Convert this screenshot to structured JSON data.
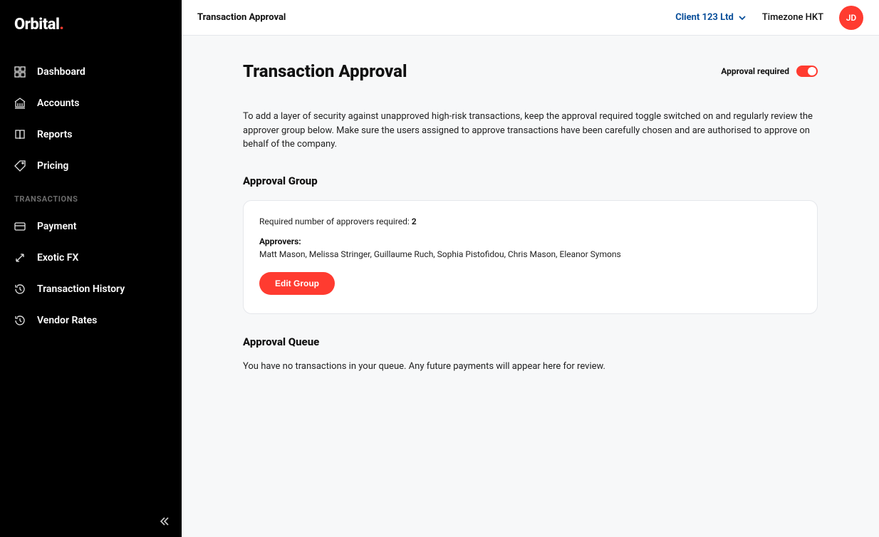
{
  "brand": {
    "name": "Orbital",
    "dot": "."
  },
  "sidebar": {
    "items": [
      {
        "label": "Dashboard",
        "icon": "dashboard-icon"
      },
      {
        "label": "Accounts",
        "icon": "bank-icon"
      },
      {
        "label": "Reports",
        "icon": "book-icon"
      },
      {
        "label": "Pricing",
        "icon": "tag-icon"
      }
    ],
    "section_label": "TRANSACTIONS",
    "tx_items": [
      {
        "label": "Payment",
        "icon": "card-icon"
      },
      {
        "label": "Exotic FX",
        "icon": "exchange-icon"
      },
      {
        "label": "Transaction History",
        "icon": "history-icon"
      },
      {
        "label": "Vendor Rates",
        "icon": "clock-icon"
      }
    ]
  },
  "header": {
    "title": "Transaction Approval",
    "client": "Client 123 Ltd",
    "timezone": "Timezone HKT",
    "avatar_initials": "JD"
  },
  "page": {
    "title": "Transaction Approval",
    "toggle_label": "Approval required",
    "toggle_on": true,
    "intro": "To add a layer of security against unapproved high-risk transactions, keep the approval required toggle switched on and regularly review the approver group below. Make sure the users assigned to approve transactions have been carefully chosen and are authorised to approve on behalf of the company.",
    "group": {
      "heading": "Approval Group",
      "required_label": "Required number of approvers required:",
      "required_count": "2",
      "approvers_label": "Approvers:",
      "approvers": "Matt Mason, Melissa Stringer, Guillaume Ruch, Sophia Pistofidou, Chris Mason, Eleanor Symons",
      "edit_button": "Edit Group"
    },
    "queue": {
      "heading": "Approval Queue",
      "empty_text": "You have no transactions in your queue. Any future payments will appear here for review."
    }
  }
}
